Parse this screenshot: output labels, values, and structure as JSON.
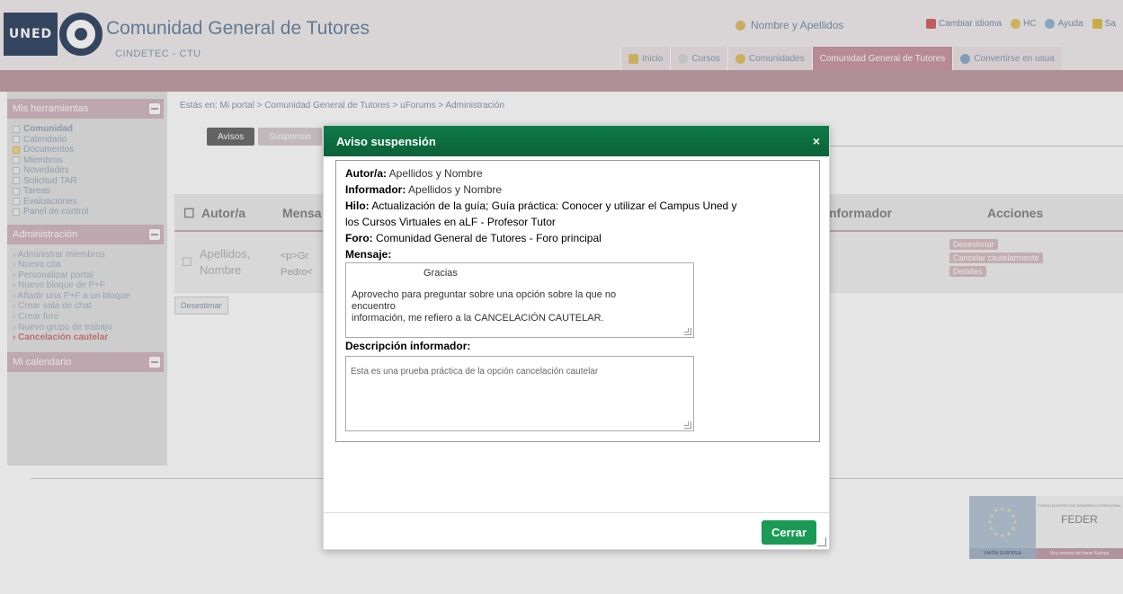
{
  "header": {
    "logo_text": "UNED",
    "site_title": "Comunidad General de Tutores",
    "site_subtitle": "CINDETEC - CTU",
    "user_name": "Nombre y Apellidos",
    "top_links": [
      "Cambiar idioma",
      "HC",
      "Ayuda",
      "Sa"
    ]
  },
  "nav": {
    "items": [
      {
        "label": "Inicio",
        "icon": "home-icon"
      },
      {
        "label": "Cursos",
        "icon": "courses-icon"
      },
      {
        "label": "Comunidades",
        "icon": "communities-icon"
      },
      {
        "label": "Comunidad General de Tutores",
        "icon": ""
      },
      {
        "label": "Convertirse en usua",
        "icon": "user-icon"
      }
    ]
  },
  "sidebar": {
    "tools_title": "Mis herramientas",
    "tools": [
      "Comunidad",
      "Calendario",
      "Documentos",
      "Miembros",
      "Novedades",
      "Solicitud TAR",
      "Tareas",
      "Evaluaciones",
      "Panel de control"
    ],
    "admin_title": "Administración",
    "admin": [
      "Administrar miembros",
      "Nueva cita",
      "Personalizar portal",
      "Nuevo bloque de P+F",
      "Añadir una P+F a un bloque",
      "Crear sala de chat",
      "Crear foro",
      "Nuevo grupo de trabajo",
      "Cancelación cautelar"
    ],
    "calendar_title": "Mi calendario"
  },
  "main": {
    "breadcrumb": "Estás en: Mi portal > Comunidad General de Tutores > uForums > Administración",
    "tabs": [
      "Avisos",
      "Suspensio"
    ],
    "columns": [
      "Autor/a",
      "Mensa",
      "nformador",
      "Acciones"
    ],
    "row": {
      "author_line1": "Apellidos,",
      "author_line2": "Nombre",
      "msg_line1": "<p>Gr",
      "msg_line2": "Pedro<"
    },
    "actions": [
      "Desestimar",
      "Cancelar cautelarmente",
      "Detalles"
    ],
    "dismiss_button": "Desestimar"
  },
  "footer": {
    "feder_label": "FEDER",
    "feder_small": "FONDO EUROPEO DE DESARROLLO REGIONAL",
    "eu_label": "UNIÓN EUROPEA",
    "feder_slogan": "Una manera de hacer Europa"
  },
  "modal": {
    "title": "Aviso suspensión",
    "close": "×",
    "autor_label": "Autor/a:",
    "autor_value": "Apellidos y Nombre",
    "informador_label": "Informador:",
    "informador_value": "Apellidos y Nombre",
    "hilo_label": "Hilo:",
    "hilo_value_1": "Actualización de la guía; Guía práctica: Conocer y utilizar el Campus Uned y",
    "hilo_value_2": "los Cursos Virtuales en aLF - Profesor Tutor",
    "foro_label": "Foro:",
    "foro_value": "Comunidad General de Tutores - Foro principal",
    "mensaje_label": "Mensaje:",
    "mensaje_line1": "Gracias",
    "mensaje_line2": "Aprovecho para preguntar sobre una opción sobre la que no",
    "mensaje_line3": "encuentro",
    "mensaje_line4": "información, me refiero a la CANCELACIÓN CAUTELAR.",
    "descripcion_label": "Descripción informador:",
    "descripcion_value": "Esta es una prueba práctica de la opción cancelación cautelar",
    "button": "Cerrar"
  }
}
